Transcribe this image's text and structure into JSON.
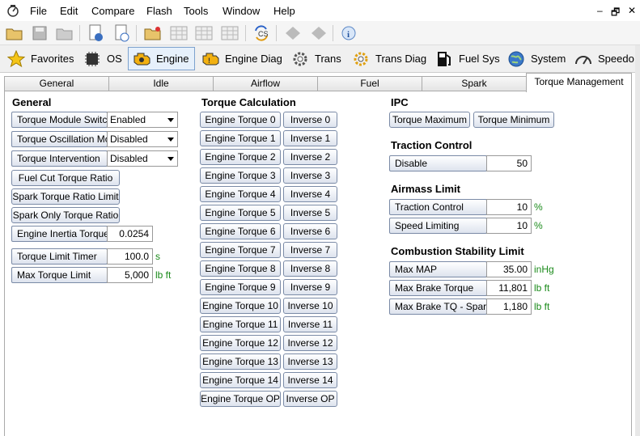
{
  "menu": {
    "items": [
      "File",
      "Edit",
      "Compare",
      "Flash",
      "Tools",
      "Window",
      "Help"
    ],
    "min": "–",
    "restore": "🗗",
    "close": "✕"
  },
  "nav": {
    "items": [
      {
        "label": "Favorites",
        "icon": "star-icon"
      },
      {
        "label": "OS",
        "icon": "chip-icon"
      },
      {
        "label": "Engine",
        "icon": "engine-icon"
      },
      {
        "label": "Engine Diag",
        "icon": "engine-diag-icon"
      },
      {
        "label": "Trans",
        "icon": "gear-icon"
      },
      {
        "label": "Trans Diag",
        "icon": "gear-diag-icon"
      },
      {
        "label": "Fuel Sys",
        "icon": "fuel-pump-icon"
      },
      {
        "label": "System",
        "icon": "globe-icon"
      },
      {
        "label": "Speedo",
        "icon": "speedometer-icon"
      }
    ],
    "active": "Engine"
  },
  "tabs": [
    "General",
    "Idle",
    "Airflow",
    "Fuel",
    "Spark",
    "Torque Management"
  ],
  "general": {
    "title": "General",
    "module_switch": {
      "label": "Torque Module Switch",
      "value": "Enabled"
    },
    "oscillation": {
      "label": "Torque Oscillation Modu",
      "value": "Disabled"
    },
    "intervention": {
      "label": "Torque Intervention",
      "value": "Disabled"
    },
    "fuel_cut": "Fuel Cut Torque Ratio",
    "spark_limit": "Spark Torque Ratio Limit",
    "spark_only": "Spark Only Torque Ratio",
    "inertia": {
      "label": "Engine Inertia Torque",
      "value": "0.0254"
    },
    "limit_timer": {
      "label": "Torque Limit Timer",
      "value": "100.0",
      "unit": "s"
    },
    "max_limit": {
      "label": "Max Torque Limit",
      "value": "5,000",
      "unit": "lb ft"
    }
  },
  "calc": {
    "title": "Torque Calculation",
    "engine": [
      "Engine Torque 0",
      "Engine Torque 1",
      "Engine Torque 2",
      "Engine Torque 3",
      "Engine Torque 4",
      "Engine Torque 5",
      "Engine Torque 6",
      "Engine Torque 7",
      "Engine Torque 8",
      "Engine Torque 9",
      "Engine Torque 10",
      "Engine Torque 11",
      "Engine Torque 12",
      "Engine Torque 13",
      "Engine Torque 14",
      "Engine Torque OP"
    ],
    "inverse": [
      "Inverse 0",
      "Inverse 1",
      "Inverse 2",
      "Inverse 3",
      "Inverse 4",
      "Inverse 5",
      "Inverse 6",
      "Inverse 7",
      "Inverse 8",
      "Inverse 9",
      "Inverse 10",
      "Inverse 11",
      "Inverse 12",
      "Inverse 13",
      "Inverse 14",
      "Inverse OP"
    ]
  },
  "ipc": {
    "title": "IPC",
    "max": "Torque Maximum",
    "min": "Torque Minimum"
  },
  "traction": {
    "title": "Traction Control",
    "disable": {
      "label": "Disable",
      "value": "50"
    }
  },
  "airmass": {
    "title": "Airmass Limit",
    "tc": {
      "label": "Traction Control",
      "value": "10",
      "unit": "%"
    },
    "speed": {
      "label": "Speed Limiting",
      "value": "10",
      "unit": "%"
    }
  },
  "combustion": {
    "title": "Combustion Stability Limit",
    "map": {
      "label": "Max MAP",
      "value": "35.00",
      "unit": "inHg"
    },
    "brake": {
      "label": "Max Brake Torque",
      "value": "11,801",
      "unit": "lb ft"
    },
    "brake_spark": {
      "label": "Max Brake TQ - Spark R",
      "value": "1,180",
      "unit": "lb ft"
    }
  }
}
